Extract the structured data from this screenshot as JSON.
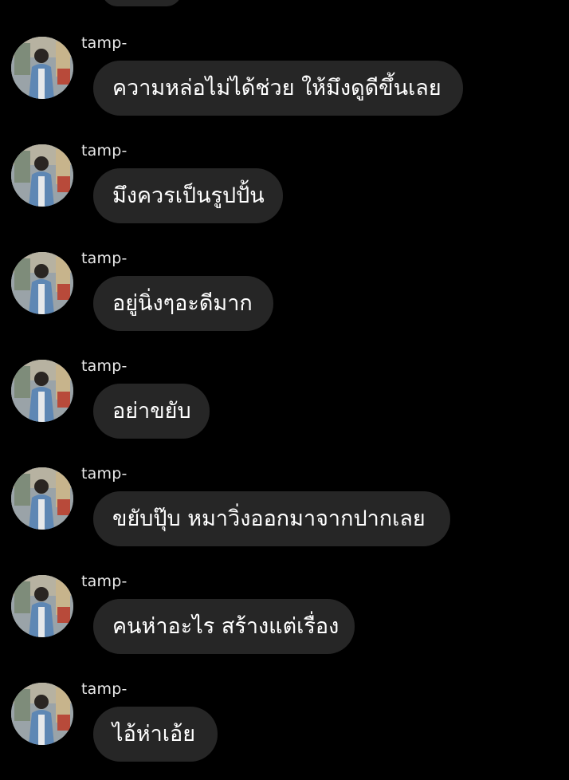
{
  "colors": {
    "background": "#000000",
    "bubble": "#262626",
    "message_text": "#ffffff",
    "sender_text": "#e9e9e9"
  },
  "messages": [
    {
      "sender": "tamp-",
      "text": "ความหล่อไม่ได้ช่วย ให้มึงดูดีขึ้นเลย"
    },
    {
      "sender": "tamp-",
      "text": "มึงควรเป็นรูปปั้น"
    },
    {
      "sender": "tamp-",
      "text": "อยู่นิ่งๆอะดีมาก"
    },
    {
      "sender": "tamp-",
      "text": "อย่าขยับ"
    },
    {
      "sender": "tamp-",
      "text": "ขยับปุ๊บ หมาวิ่งออกมาจากปากเลย"
    },
    {
      "sender": "tamp-",
      "text": "คนห่าอะไร สร้างแต่เรื่อง"
    },
    {
      "sender": "tamp-",
      "text": "ไอ้ห่าเอ้ย"
    }
  ]
}
